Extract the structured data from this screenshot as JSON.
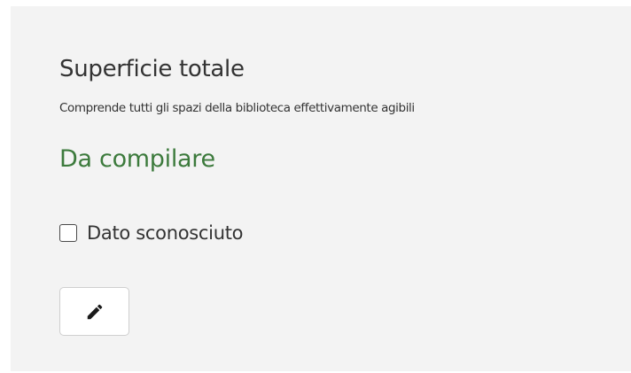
{
  "field": {
    "title": "Superficie totale",
    "description": "Comprende tutti gli spazi della biblioteca effettivamente agibili",
    "status": "Da compilare"
  },
  "unknown_checkbox": {
    "label": "Dato sconosciuto",
    "checked": false
  },
  "edit_button": {
    "icon": "pencil-icon"
  },
  "colors": {
    "panel_background": "#f3f3f3",
    "status_text": "#3c7a3c",
    "text": "#333333"
  }
}
